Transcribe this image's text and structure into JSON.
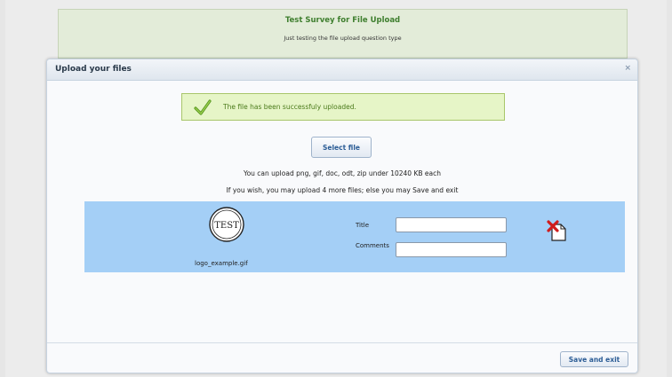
{
  "survey": {
    "title": "Test Survey for File Upload",
    "description": "Just testing the file upload question type"
  },
  "dialog": {
    "title": "Upload your files",
    "close_icon": "×"
  },
  "success": {
    "icon": "check-icon",
    "message": "The file has been successfuly uploaded."
  },
  "select_file_label": "Select file",
  "info": {
    "line1": "You can upload png, gif, doc, odt, zip under 10240 KB each",
    "line2": "If you wish, you may upload 4 more files; else you may Save and exit"
  },
  "file": {
    "thumbnail_text": "TEST",
    "name": "logo_example.gif",
    "title_label": "Title",
    "title_value": "",
    "comments_label": "Comments",
    "comments_value": "",
    "delete_icon": "delete-file-icon"
  },
  "save_exit_label": "Save and exit",
  "colors": {
    "success_bg": "#e6f5c7",
    "file_row_bg": "#a4cff6",
    "header_bg": "#e3ecd9",
    "button_text": "#2c5d96"
  }
}
